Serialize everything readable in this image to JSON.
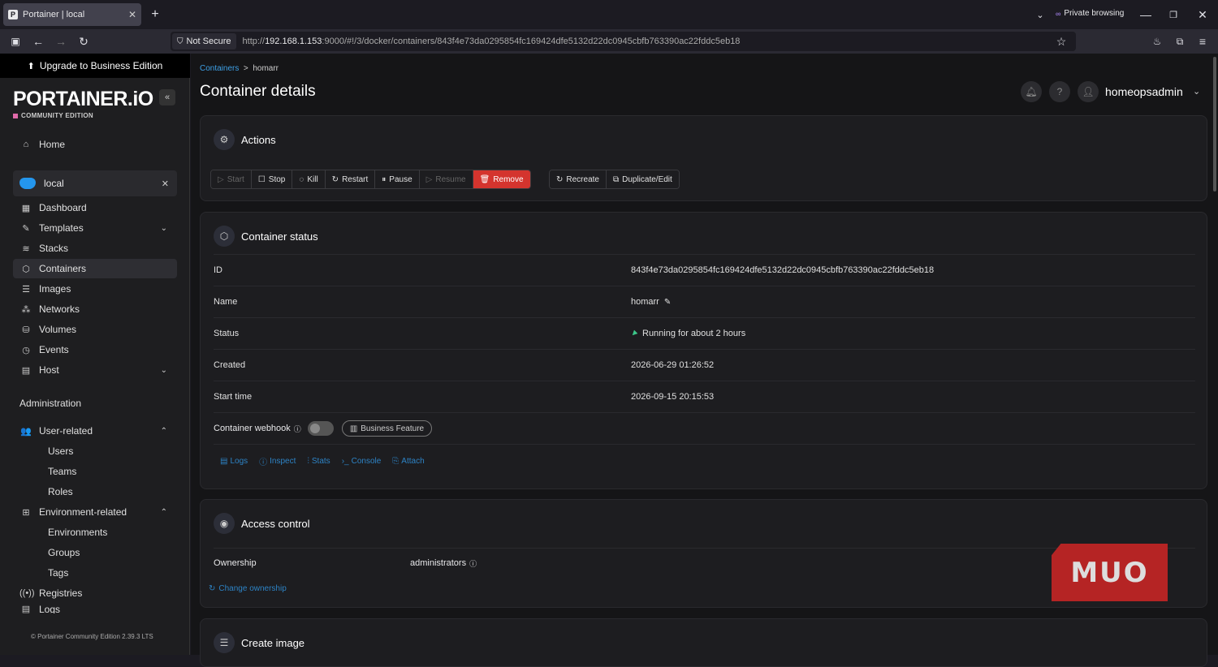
{
  "browser": {
    "tab_title": "Portainer | local",
    "favicon_letter": "P",
    "private_label": "Private browsing",
    "not_secure": "Not Secure",
    "url_prefix": "http://",
    "url_host": "192.168.1.153",
    "url_rest": ":9000/#!/3/docker/containers/843f4e73da0295854fc169424dfe5132d22dc0945cbfb763390ac22fddc5eb18"
  },
  "sidebar": {
    "upgrade": "Upgrade to Business Edition",
    "logo": "PORTAINER.iO",
    "edition": "COMMUNITY EDITION",
    "home": "Home",
    "environment": "local",
    "items": [
      "Dashboard",
      "Templates",
      "Stacks",
      "Containers",
      "Images",
      "Networks",
      "Volumes",
      "Events",
      "Host"
    ],
    "admin_heading": "Administration",
    "user_related": "User-related",
    "user_sub": [
      "Users",
      "Teams",
      "Roles"
    ],
    "env_related": "Environment-related",
    "env_sub": [
      "Environments",
      "Groups",
      "Tags"
    ],
    "registries": "Registries",
    "logs": "Logs",
    "footer": "Portainer Community Edition 2.39.3 LTS"
  },
  "header": {
    "crumb_link": "Containers",
    "crumb_sep": ">",
    "crumb_current": "homarr",
    "title": "Container details",
    "username": "homeopsadmin"
  },
  "actions": {
    "title": "Actions",
    "buttons": [
      "Start",
      "Stop",
      "Kill",
      "Restart",
      "Pause",
      "Resume",
      "Remove"
    ],
    "buttons2": [
      "Recreate",
      "Duplicate/Edit"
    ]
  },
  "status": {
    "title": "Container status",
    "rows": [
      {
        "k": "ID",
        "v": "843f4e73da0295854fc169424dfe5132d22dc0945cbfb763390ac22fddc5eb18"
      },
      {
        "k": "Name",
        "v": "homarr"
      },
      {
        "k": "Status",
        "v": "Running for about 2 hours"
      },
      {
        "k": "Created",
        "v": "2026-06-29 01:26:52"
      },
      {
        "k": "Start time",
        "v": "2026-09-15 20:15:53"
      }
    ],
    "webhook_label": "Container webhook",
    "business_feature": "Business Feature",
    "links": [
      "Logs",
      "Inspect",
      "Stats",
      "Console",
      "Attach"
    ]
  },
  "access": {
    "title": "Access control",
    "ownership_label": "Ownership",
    "ownership_value": "administrators",
    "change_link": "Change ownership"
  },
  "create_image": {
    "title": "Create image"
  },
  "watermark": "MUO"
}
